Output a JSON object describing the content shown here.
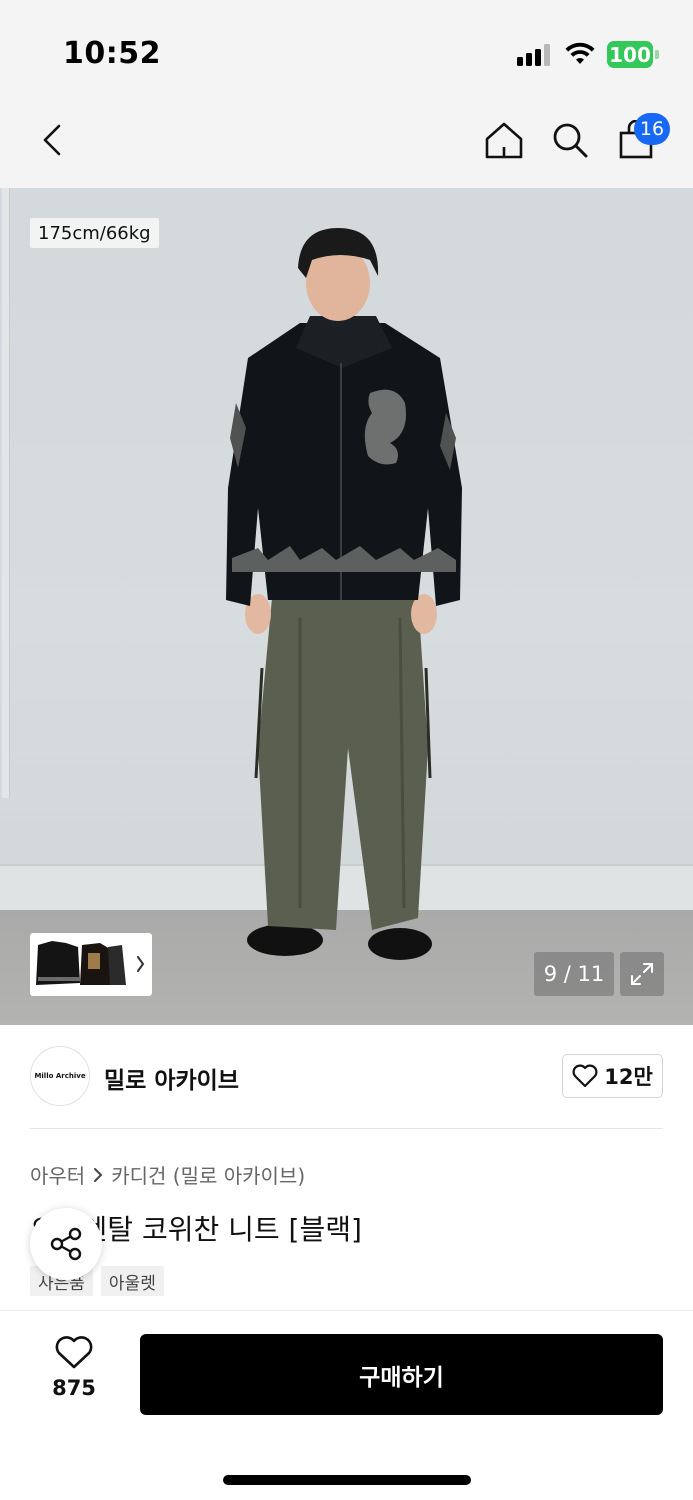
{
  "status_bar": {
    "time": "10:52",
    "battery": "100",
    "icons": [
      "signal-icon",
      "wifi-icon",
      "battery-icon"
    ]
  },
  "nav": {
    "icons": [
      "back-arrow-icon",
      "home-icon",
      "search-icon",
      "shopping-bag-icon"
    ],
    "cart_badge": "16"
  },
  "gallery": {
    "model_size": "175cm/66kg",
    "counter": "9 / 11",
    "icons": [
      "chevron-right-icon",
      "expand-icon"
    ]
  },
  "brand": {
    "logo_text": "Millo Archive",
    "name": "밀로 아카이브",
    "likes": "12만"
  },
  "product": {
    "breadcrumb": [
      "아우터",
      "카디건 (밀로 아카이브)"
    ],
    "title": "오리엔탈 코위찬 니트 [블랙]",
    "tags": [
      "사은품",
      "아울렛"
    ]
  },
  "actions": {
    "wish_count": "875",
    "buy_label": "구매하기",
    "icons": [
      "share-icon",
      "heart-icon"
    ]
  },
  "colors": {
    "accent_blue": "#1769f5",
    "battery_green": "#34c759",
    "buy_button": "#000000"
  }
}
